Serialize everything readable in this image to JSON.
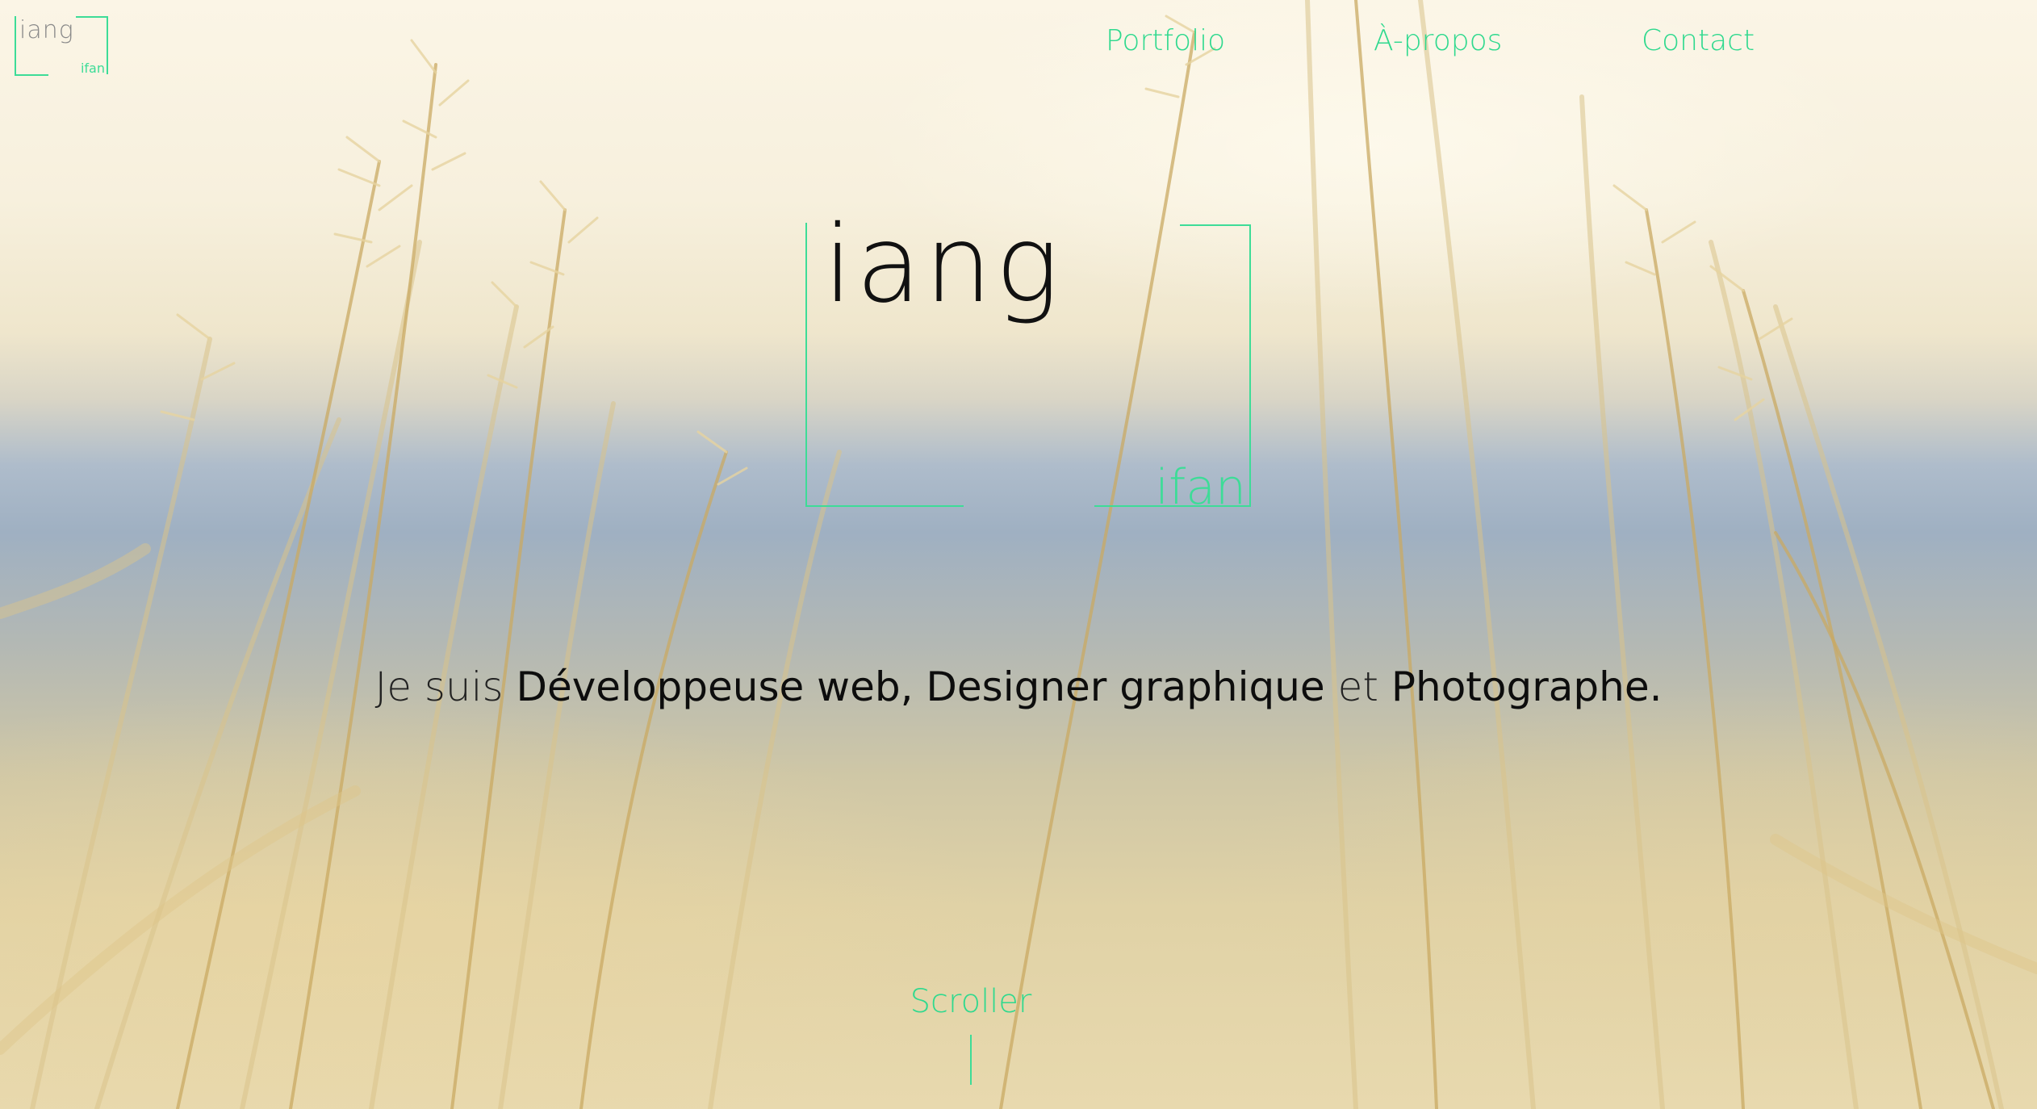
{
  "brand": {
    "logo_primary": "iang",
    "logo_secondary": "ifan",
    "accent_color": "#3ddc97"
  },
  "nav": {
    "items": [
      {
        "label": "Portfolio"
      },
      {
        "label": "À-propos"
      },
      {
        "label": "Contact"
      }
    ]
  },
  "hero": {
    "intro": "Je suis",
    "role1": "Développeuse web,",
    "role2": "Designer graphique",
    "conj": "et",
    "role3": "Photographe."
  },
  "scroll": {
    "label": "Scroller"
  }
}
